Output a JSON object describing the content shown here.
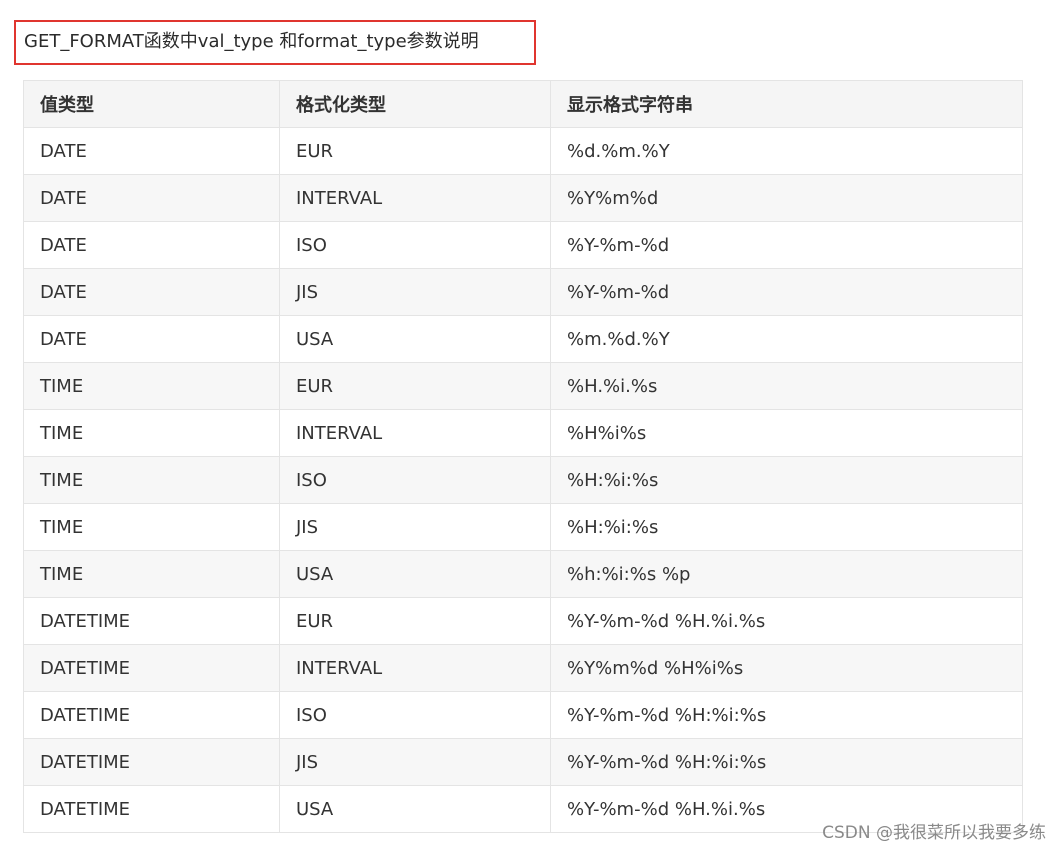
{
  "caption": "GET_FORMAT函数中val_type 和format_type参数说明",
  "table": {
    "headers": [
      "值类型",
      "格式化类型",
      "显示格式字符串"
    ],
    "rows": [
      [
        "DATE",
        "EUR",
        "%d.%m.%Y"
      ],
      [
        "DATE",
        "INTERVAL",
        "%Y%m%d"
      ],
      [
        "DATE",
        "ISO",
        "%Y-%m-%d"
      ],
      [
        "DATE",
        "JIS",
        "%Y-%m-%d"
      ],
      [
        "DATE",
        "USA",
        "%m.%d.%Y"
      ],
      [
        "TIME",
        "EUR",
        "%H.%i.%s"
      ],
      [
        "TIME",
        "INTERVAL",
        "%H%i%s"
      ],
      [
        "TIME",
        "ISO",
        "%H:%i:%s"
      ],
      [
        "TIME",
        "JIS",
        "%H:%i:%s"
      ],
      [
        "TIME",
        "USA",
        "%h:%i:%s %p"
      ],
      [
        "DATETIME",
        "EUR",
        "%Y-%m-%d %H.%i.%s"
      ],
      [
        "DATETIME",
        "INTERVAL",
        "%Y%m%d %H%i%s"
      ],
      [
        "DATETIME",
        "ISO",
        "%Y-%m-%d %H:%i:%s"
      ],
      [
        "DATETIME",
        "JIS",
        "%Y-%m-%d %H:%i:%s"
      ],
      [
        "DATETIME",
        "USA",
        "%Y-%m-%d %H.%i.%s"
      ]
    ]
  },
  "watermark": "CSDN @我很菜所以我要多练",
  "colors": {
    "highlight_border": "#e0352f",
    "header_bg": "#f5f5f5",
    "stripe_bg": "#f7f7f7",
    "grid_line": "#e4e4e4"
  }
}
